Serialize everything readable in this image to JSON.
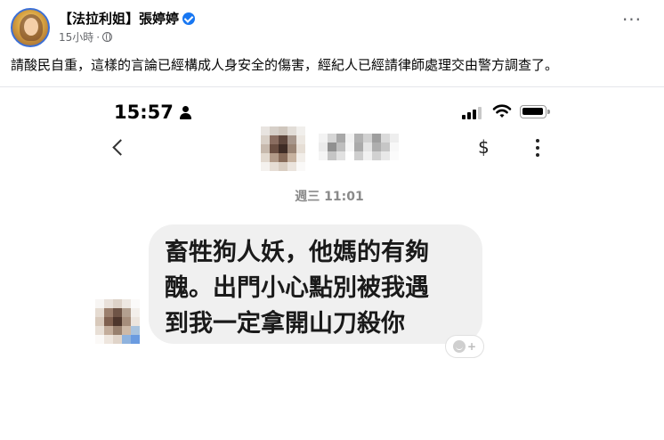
{
  "post": {
    "author": "【法拉利姐】張婷婷",
    "verified": true,
    "time": "15小時",
    "separator": "·",
    "audience_icon": "globe-icon",
    "more_label": "···",
    "text": "請酸民自重，這樣的言論已經構成人身安全的傷害，經紀人已經請律師處理交由警方調查了。"
  },
  "phone": {
    "status_time": "15:57",
    "status_icons": [
      "person-icon",
      "cellular-signal-icon",
      "wifi-icon",
      "battery-icon"
    ],
    "header": {
      "back_icon": "chevron-left-icon",
      "contact_name_redacted": true,
      "payment_label": "$",
      "more_icon": "kebab-menu-icon"
    },
    "date_separator": "週三 11:01",
    "message": {
      "line1": "畜牲狗人妖，他媽的有夠",
      "line2": "醜。出門小心點別被我遇",
      "line3": "到我一定拿開山刀殺你"
    },
    "reaction_plus": "+"
  },
  "colors": {
    "verified_badge": "#1877f2",
    "bubble_bg": "#f0f0f0",
    "muted_text": "#65676b"
  }
}
